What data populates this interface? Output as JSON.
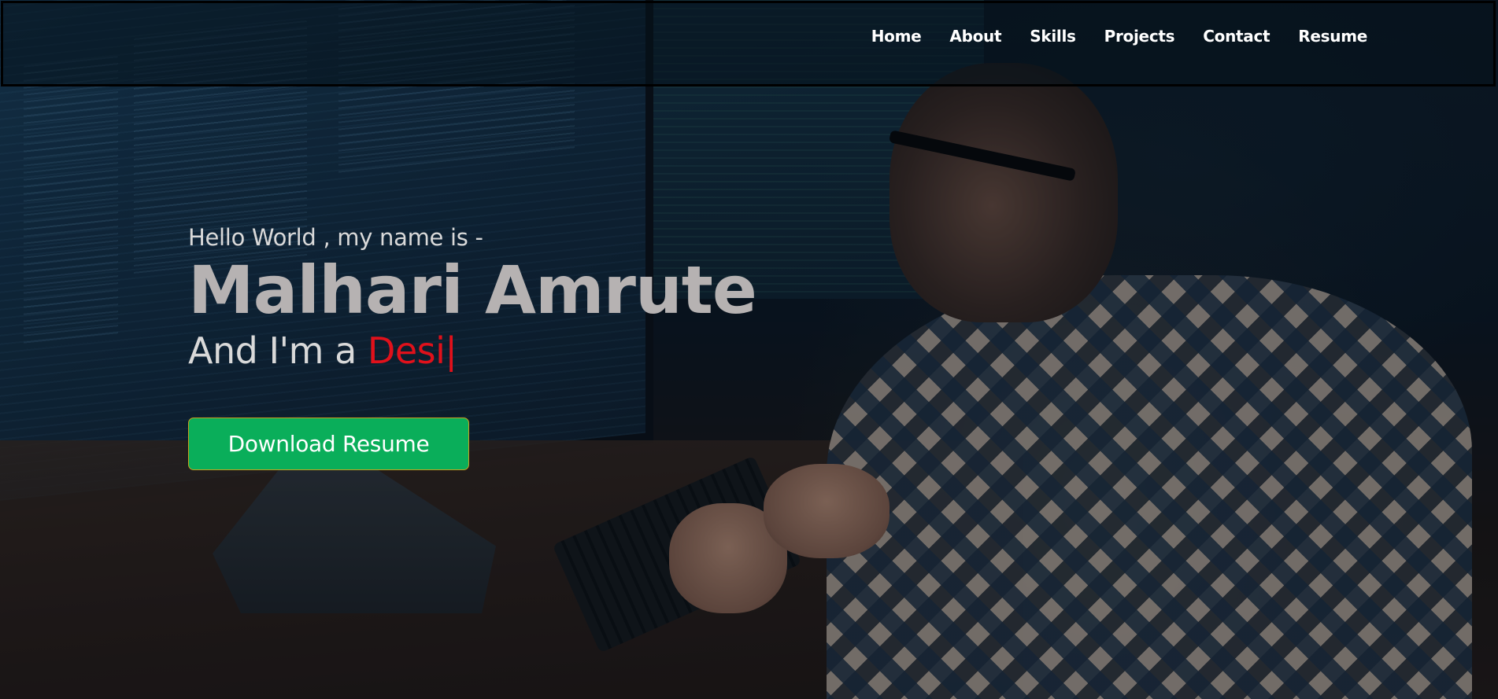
{
  "nav": {
    "items": [
      {
        "label": "Home"
      },
      {
        "label": "About"
      },
      {
        "label": "Skills"
      },
      {
        "label": "Projects"
      },
      {
        "label": "Contact"
      },
      {
        "label": "Resume"
      }
    ]
  },
  "hero": {
    "greeting": "Hello World , my name is -",
    "name": "Malhari Amrute",
    "role_prefix": "And I'm a ",
    "role_typed": "Desi",
    "cursor": "|",
    "cta_label": "Download Resume",
    "accent_color": "#e0111b",
    "cta_color": "#0aae5a"
  }
}
